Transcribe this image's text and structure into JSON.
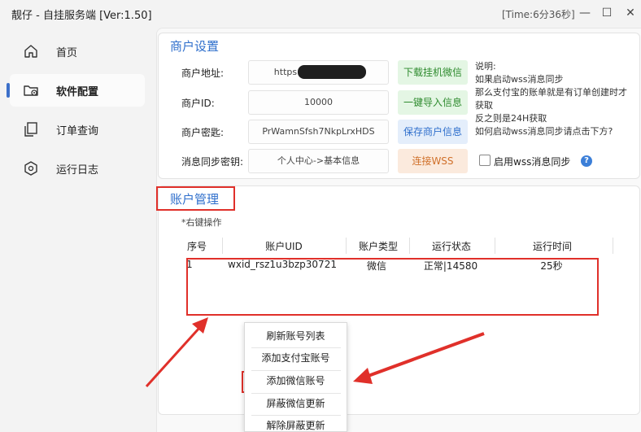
{
  "window": {
    "title": "靓仔 - 自挂服务端 [Ver:1.50]",
    "time": "[Time:6分36秒]",
    "minimize_label": "—",
    "maximize_label": "☐",
    "close_label": "✕"
  },
  "sidebar": {
    "items": [
      {
        "label": "首页",
        "icon": "home-icon"
      },
      {
        "label": "软件配置",
        "icon": "software-config-icon",
        "active": true
      },
      {
        "label": "订单查询",
        "icon": "copy-icon"
      },
      {
        "label": "运行日志",
        "icon": "hexagon-icon"
      }
    ]
  },
  "merchant": {
    "section_title": "商户设置",
    "address_label": "商户地址:",
    "address_value": "https://",
    "id_label": "商户ID:",
    "id_value": "10000",
    "key_label": "商户密匙:",
    "key_value": "PrWamnSfsh7NkpLrxHDS",
    "sync_label": "消息同步密钥:",
    "sync_value": "个人中心->基本信息",
    "download_button": "下载挂机微信",
    "import_button": "一键导入信息",
    "save_button": "保存商户信息",
    "connect_button": "连接WSS",
    "wss_checkbox_label": "启用wss消息同步",
    "help": "?",
    "info_lines": [
      "说明:",
      "如果启动wss消息同步",
      "那么支付宝的账单就是有订单创建时才",
      "获取",
      "反之则是24H获取",
      "如何启动wss消息同步请点击下方?"
    ]
  },
  "accounts": {
    "section_title": "账户管理",
    "hint": "*右键操作",
    "columns": [
      "序号",
      "账户UID",
      "账户类型",
      "运行状态",
      "运行时间"
    ],
    "rows": [
      {
        "index": "1",
        "uid": "wxid_rsz1u3bzp30721",
        "type": "微信",
        "status": "正常|14580",
        "runtime": "25秒"
      }
    ]
  },
  "context_menu": {
    "items": [
      "刷新账号列表",
      "添加支付宝账号",
      "添加微信账号",
      "屏蔽微信更新",
      "解除屏蔽更新"
    ]
  },
  "colors": {
    "accent": "#2f6fcc",
    "highlight_red": "#e0302a"
  }
}
